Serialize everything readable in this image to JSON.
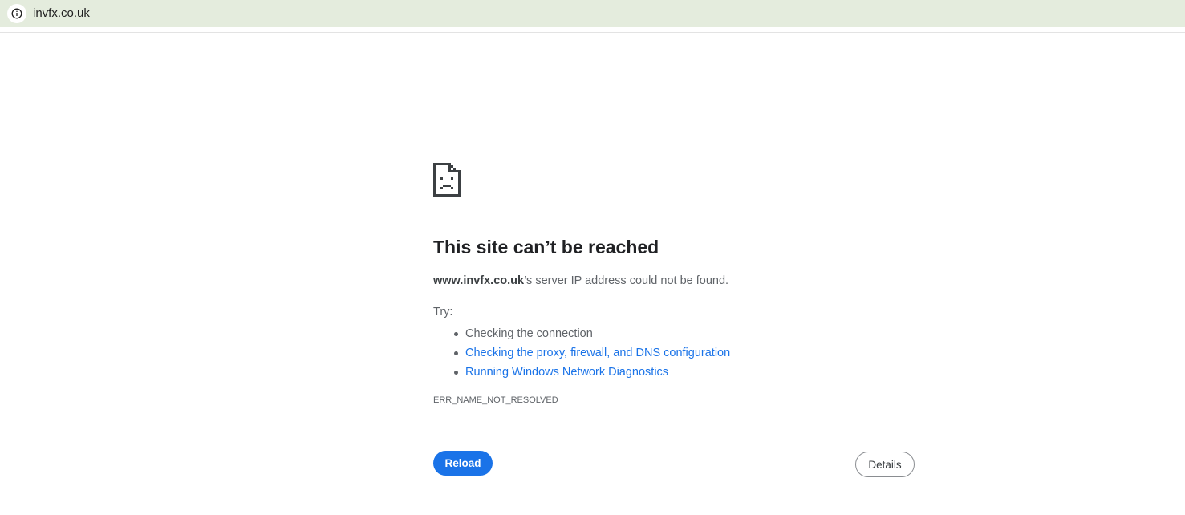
{
  "browser": {
    "url": "invfx.co.uk",
    "site_info_icon": "info-circle-icon",
    "addressbar_color": "#e4ecdd"
  },
  "error_page": {
    "icon": "sad-page-icon",
    "title": "This site can’t be reached",
    "host": "www.invfx.co.uk",
    "description_suffix": "’s server IP address could not be found.",
    "try_label": "Try:",
    "suggestions": [
      {
        "text": "Checking the connection",
        "is_link": false
      },
      {
        "text": "Checking the proxy, firewall, and DNS configuration",
        "is_link": true
      },
      {
        "text": "Running Windows Network Diagnostics",
        "is_link": true
      }
    ],
    "error_code": "ERR_NAME_NOT_RESOLVED",
    "reload_label": "Reload",
    "details_label": "Details",
    "accent_color": "#1a73e8",
    "link_color": "#1a73e8"
  }
}
